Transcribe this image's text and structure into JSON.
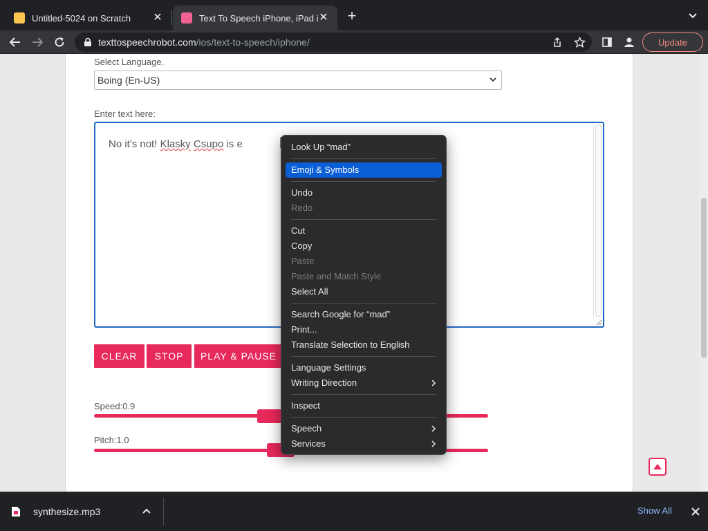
{
  "tabs": [
    {
      "title": "Untitled-5024 on Scratch",
      "favicon_color": "#f9c74f",
      "close": "✕"
    },
    {
      "title": "Text To Speech iPhone, iPad iOS",
      "favicon_color": "#f06292",
      "close": "✕"
    }
  ],
  "new_tab": "+",
  "address": {
    "host": "texttospeechrobot.com",
    "path": "/ios/text-to-speech/iphone/"
  },
  "update_label": "Update",
  "page": {
    "language_label": "Select Language.",
    "language_value": "Boing (En-US)",
    "text_label": "Enter text here:",
    "text_before": "No it's not! ",
    "text_misspelled_1": "Klasky",
    "text_space": " ",
    "text_misspelled_2": "Csupo",
    "text_after": " is e",
    "buttons": {
      "clear": "CLEAR",
      "stop": "STOP",
      "play_pause": "PLAY & PAUSE"
    },
    "speed_label": "Speed:0.9",
    "pitch_label": "Pitch:1.0",
    "accent_color": "#e8295b"
  },
  "context_menu": {
    "items": [
      {
        "label": "Look Up “mad”"
      },
      {
        "label": "Emoji & Symbols"
      },
      {
        "label": "Undo"
      },
      {
        "label": "Redo"
      },
      {
        "label": "Cut"
      },
      {
        "label": "Copy"
      },
      {
        "label": "Paste"
      },
      {
        "label": "Paste and Match Style"
      },
      {
        "label": "Select All"
      },
      {
        "label": "Search Google for “mad”"
      },
      {
        "label": "Print..."
      },
      {
        "label": "Translate Selection to English"
      },
      {
        "label": "Language Settings"
      },
      {
        "label": "Writing Direction"
      },
      {
        "label": "Inspect"
      },
      {
        "label": "Speech"
      },
      {
        "label": "Services"
      }
    ]
  },
  "download_bar": {
    "file_name": "synthesize.mp3",
    "show_all": "Show All"
  }
}
